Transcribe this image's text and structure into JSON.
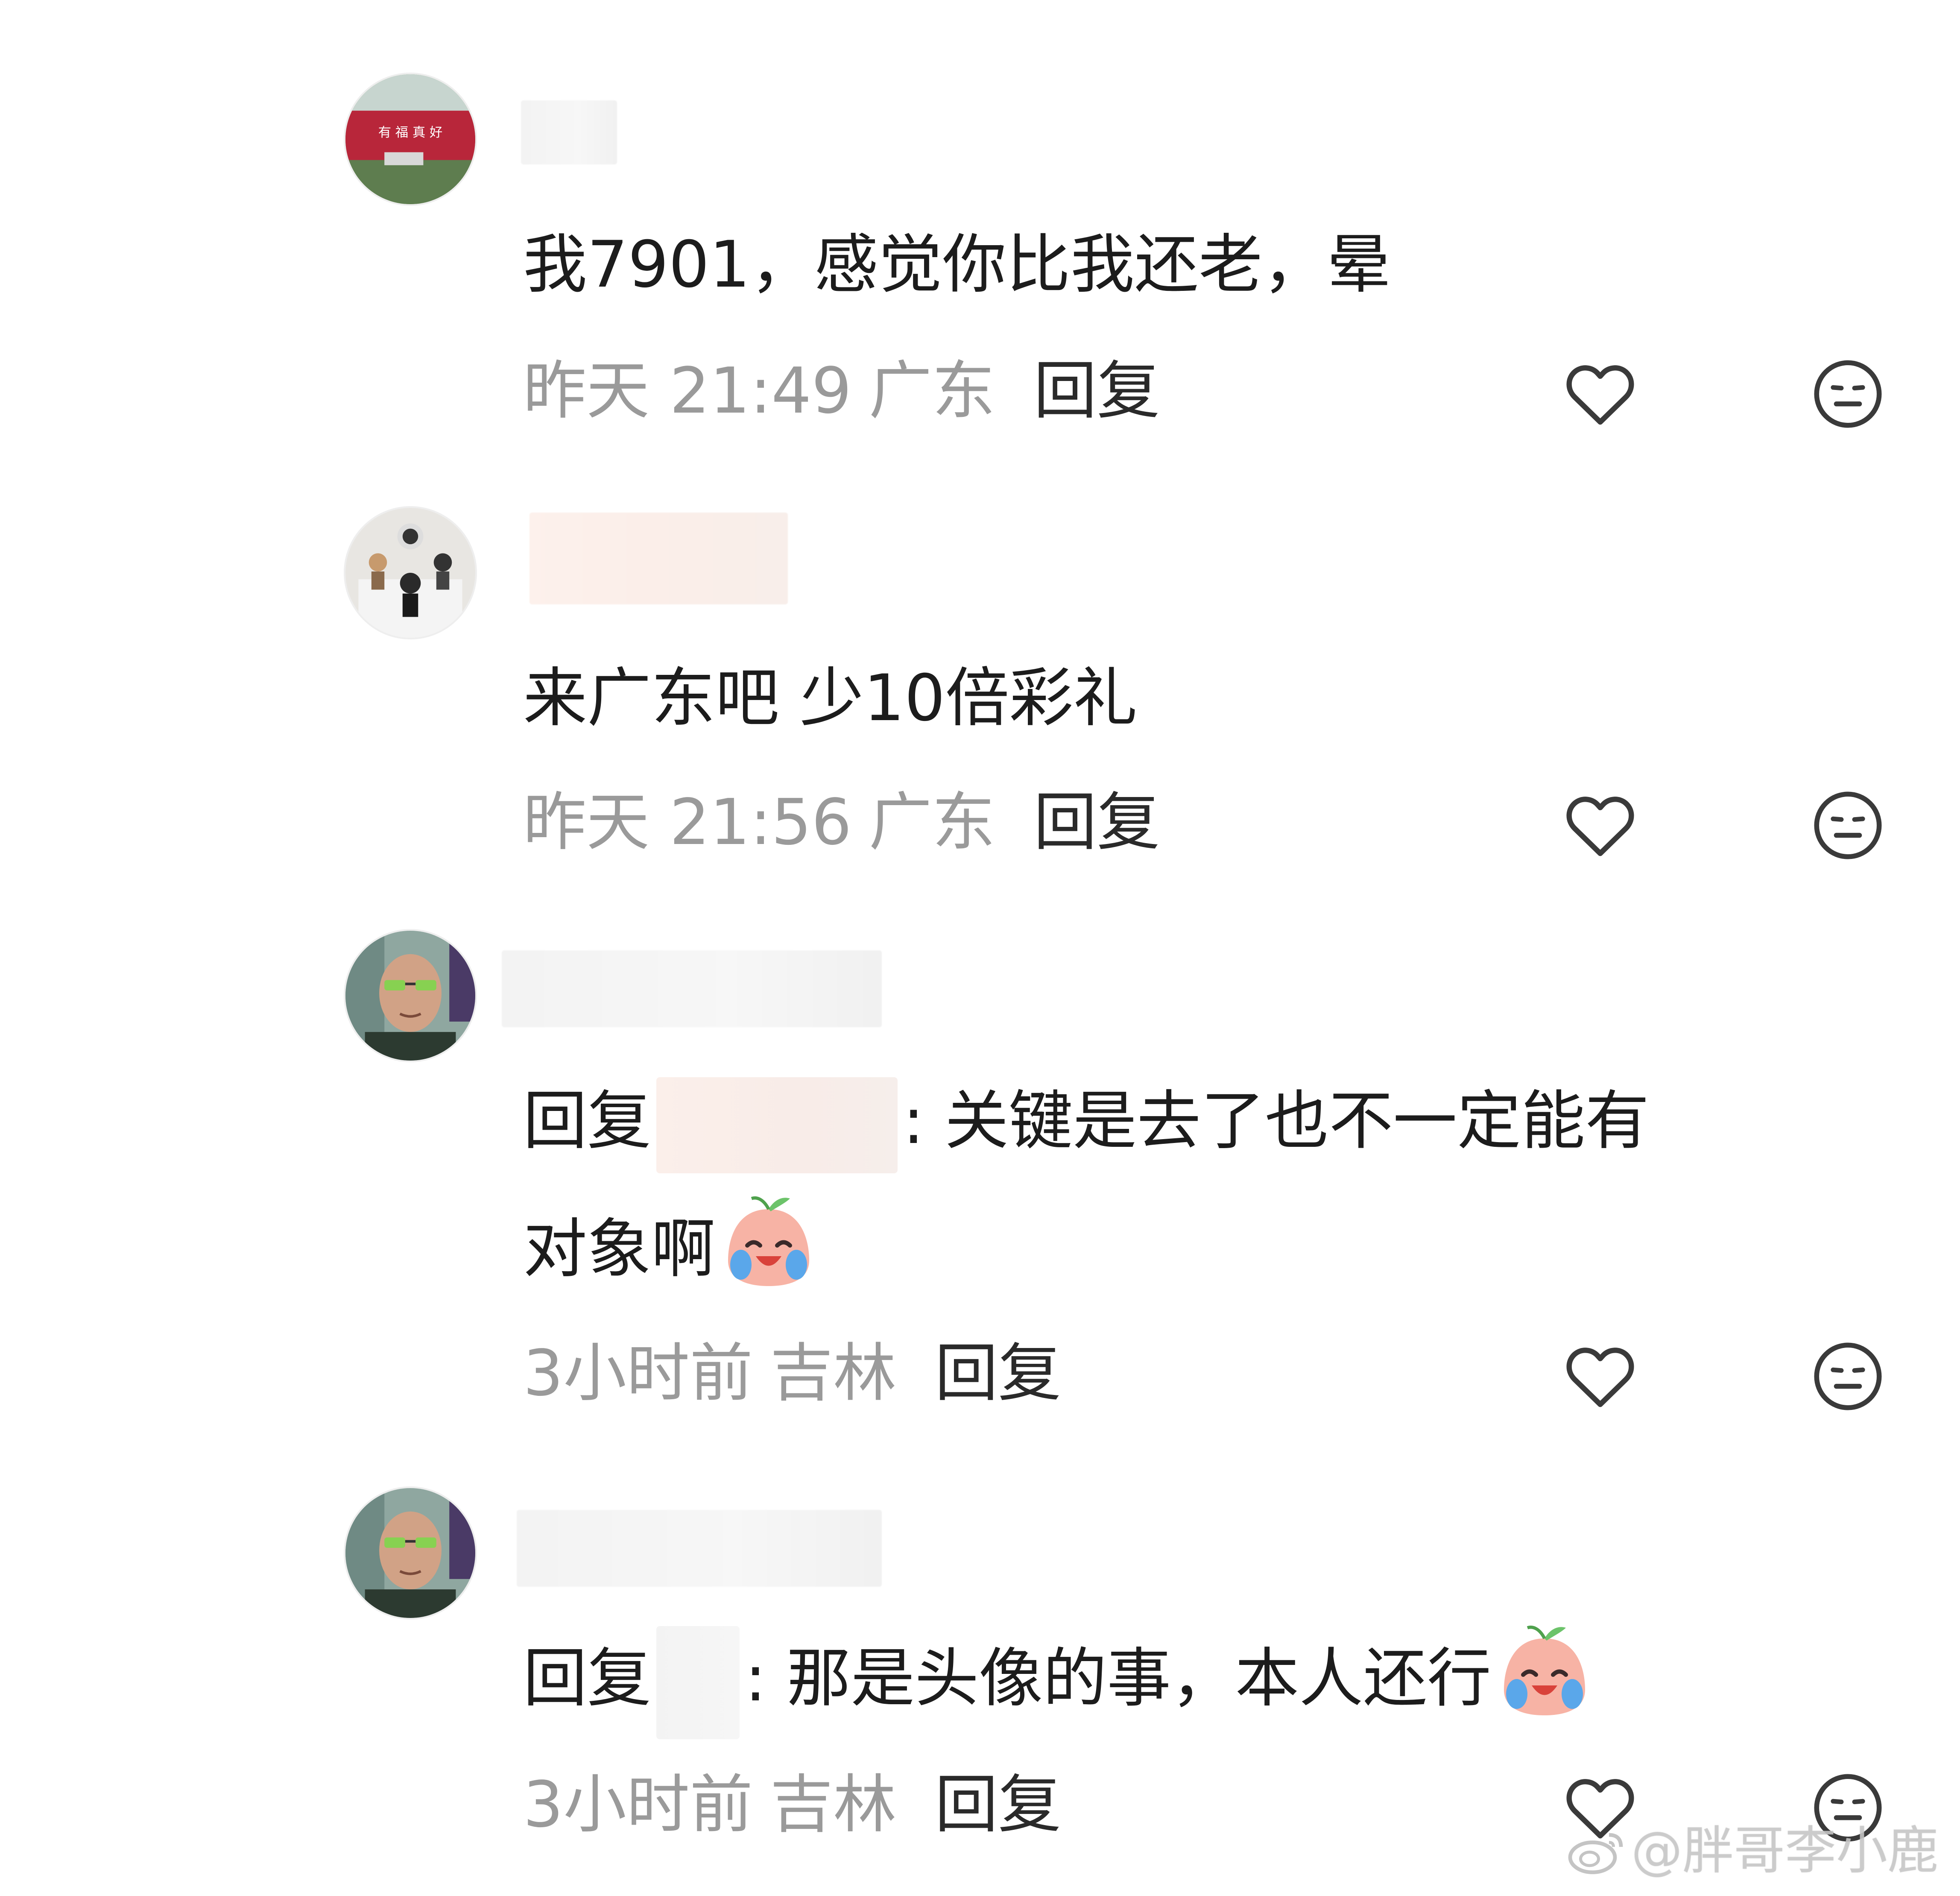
{
  "comments": [
    {
      "text": "我7901，感觉你比我还老，晕",
      "time": "昨天 21:49",
      "location": "广东",
      "reply_label": "回复"
    },
    {
      "text": "来广东吧 少10倍彩礼",
      "time": "昨天 21:56",
      "location": "广东",
      "reply_label": "回复"
    },
    {
      "reply_prefix": "回复",
      "text_line1": ": 关键是去了也不一定能有",
      "text_line2": "对象啊",
      "time": "3小时前",
      "location": "吉林",
      "reply_label": "回复"
    },
    {
      "reply_prefix": "回复",
      "text": ": 那是头像的事，本人还行",
      "time": "3小时前",
      "location": "吉林",
      "reply_label": "回复"
    }
  ],
  "icons": {
    "like": "heart-outline-icon",
    "dislike": "neutral-face-icon",
    "emoji": "laugh-cry-emoji"
  },
  "watermark": "@胖哥李小鹿",
  "colors": {
    "text": "#1c1c1c",
    "meta": "#9a9a9a",
    "icon_stroke": "#3a3a3a"
  }
}
